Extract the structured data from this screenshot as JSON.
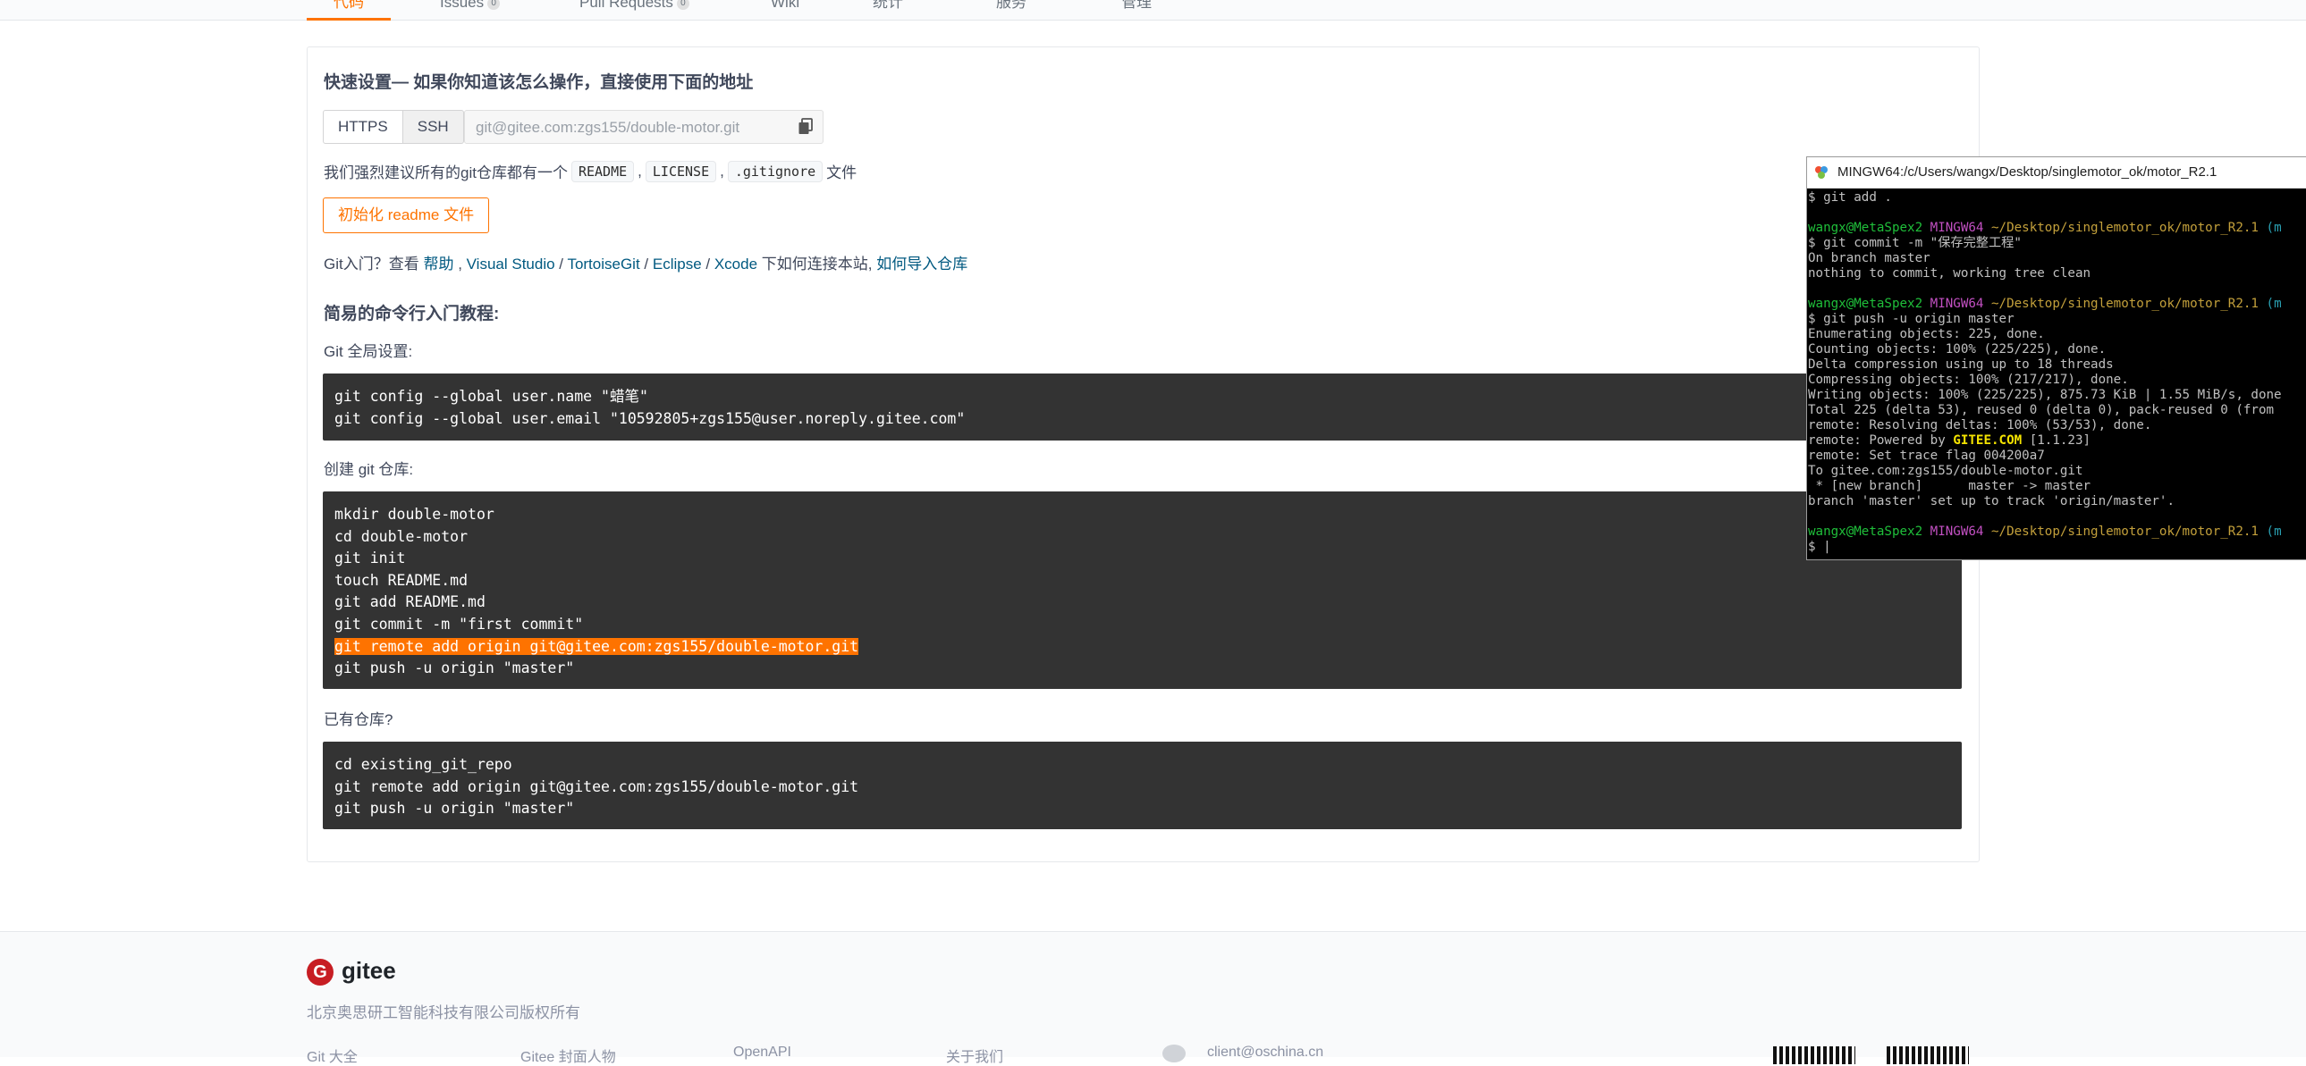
{
  "tabs": [
    {
      "label": "代码",
      "active": true
    },
    {
      "label": "Issues",
      "count": "0"
    },
    {
      "label": "Pull Requests",
      "count": "0"
    },
    {
      "label": "Wiki"
    },
    {
      "label": "统计"
    },
    {
      "label": "服务"
    },
    {
      "label": "管理"
    }
  ],
  "quick_setup": {
    "title": "快速设置— 如果你知道该怎么操作，直接使用下面的地址",
    "https_label": "HTTPS",
    "ssh_label": "SSH",
    "url_value": "git@gitee.com:zgs155/double-motor.git",
    "recommend_prefix": "我们强烈建议所有的git仓库都有一个",
    "readme_chip": "README",
    "license_chip": "LICENSE",
    "gitignore_chip": ".gitignore",
    "comma1": ",",
    "comma2": ",",
    "recommend_suffix": "文件",
    "init_readme_label": "初始化 readme 文件",
    "intro_prefix": "Git入门？查看",
    "help_link": "帮助",
    "vs_link": "Visual Studio",
    "tortoise_link": "TortoiseGit",
    "eclipse_link": "Eclipse",
    "xcode_link": "Xcode",
    "intro_mid": "下如何连接本站,",
    "import_link": "如何导入仓库"
  },
  "cli": {
    "title": "简易的命令行入门教程:",
    "global_label": "Git 全局设置:",
    "global_lines": [
      "git config --global user.name \"蜡笔\"",
      "git config --global user.email \"10592805+zgs155@user.noreply.gitee.com\""
    ],
    "create_label": "创建 git 仓库:",
    "create_lines": [
      "mkdir double-motor",
      "cd double-motor",
      "git init",
      "touch README.md",
      "git add README.md",
      "git commit -m \"first commit\"",
      "git remote add origin git@gitee.com:zgs155/double-motor.git",
      "git push -u origin \"master\""
    ],
    "existing_label": "已有仓库?",
    "existing_lines": [
      "cd existing_git_repo",
      "git remote add origin git@gitee.com:zgs155/double-motor.git",
      "git push -u origin \"master\""
    ]
  },
  "footer": {
    "logo_text": "gitee",
    "copyright": "北京奥思研工智能科技有限公司版权所有",
    "links": [
      "Git 大全",
      "Gitee 封面人物",
      "OpenAPI",
      "关于我们",
      "client@oschina.cn"
    ]
  },
  "terminal": {
    "title": "MINGW64:/c/Users/wangx/Desktop/singlemotor_ok/motor_R2.1",
    "line_git_add": "$ git add .",
    "prompt_user": "wangx@MetaSpex2",
    "prompt_env": "MINGW64",
    "prompt_path": "~/Desktop/singlemotor_ok/motor_R2.1",
    "prompt_branch": "(m",
    "line_commit": "$ git commit -m \"保存完整工程\"",
    "line_on_branch": "On branch master",
    "line_nothing": "nothing to commit, working tree clean",
    "line_push": "$ git push -u origin master",
    "line_enum": "Enumerating objects: 225, done.",
    "line_count": "Counting objects: 100% (225/225), done.",
    "line_delta": "Delta compression using up to 18 threads",
    "line_compress": "Compressing objects: 100% (217/217), done.",
    "line_writing": "Writing objects: 100% (225/225), 875.73 KiB | 1.55 MiB/s, done",
    "line_total": "Total 225 (delta 53), reused 0 (delta 0), pack-reused 0 (from",
    "line_resolving": "remote: Resolving deltas: 100% (53/53), done.",
    "line_powered_pre": "remote: Powered by ",
    "line_powered_brand": "GITEE.COM",
    "line_powered_post": " [1.1.23]",
    "line_trace": "remote: Set trace flag 004200a7",
    "line_to": "To gitee.com:zgs155/double-motor.git",
    "line_newbranch": " * [new branch]      master -> master",
    "line_track": "branch 'master' set up to track 'origin/master'.",
    "line_cursor": "$ |"
  }
}
